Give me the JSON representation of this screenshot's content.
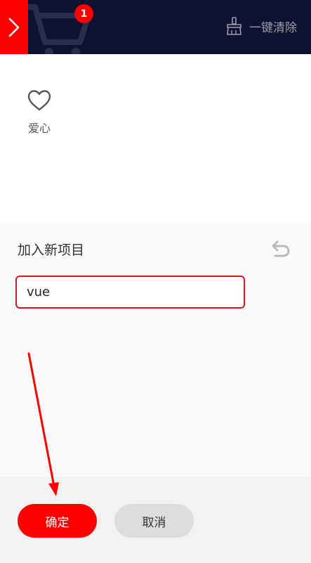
{
  "header": {
    "cart_badge": "1",
    "clear_label": "一键清除",
    "accent_color": "#ff0000",
    "background_color": "#0e1130"
  },
  "favorites": {
    "items": [
      {
        "label": "爱心",
        "icon": "heart-icon"
      }
    ]
  },
  "add_panel": {
    "title": "加入新项目",
    "input_value": "vue"
  },
  "footer": {
    "confirm_label": "确定",
    "cancel_label": "取消"
  }
}
